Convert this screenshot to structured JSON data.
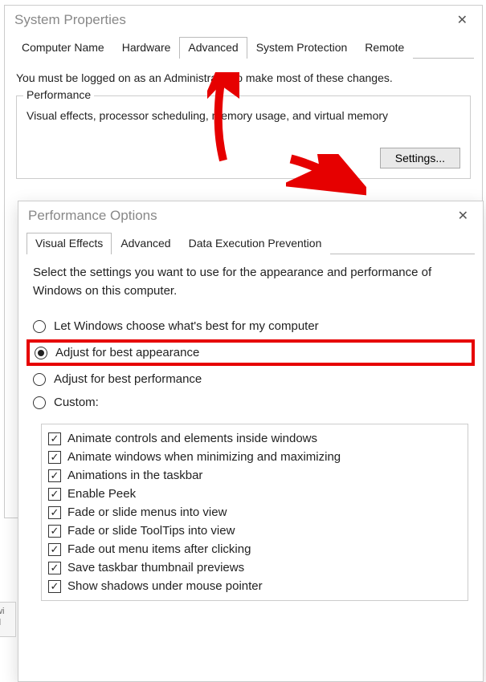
{
  "sysprops": {
    "title": "System Properties",
    "tabs": {
      "computer_name": "Computer Name",
      "hardware": "Hardware",
      "advanced": "Advanced",
      "system_protection": "System Protection",
      "remote": "Remote"
    },
    "instruction": "You must be logged on as an Administrator to make most of these changes.",
    "performance": {
      "group_label": "Performance",
      "description": "Visual effects, processor scheduling, memory usage, and virtual memory",
      "settings_button": "Settings..."
    }
  },
  "perfopts": {
    "title": "Performance Options",
    "tabs": {
      "visual_effects": "Visual Effects",
      "advanced": "Advanced",
      "dep": "Data Execution Prevention"
    },
    "instruction": "Select the settings you want to use for the appearance and performance of Windows on this computer.",
    "radios": {
      "let_windows": "Let Windows choose what's best for my computer",
      "best_appearance": "Adjust for best appearance",
      "best_performance": "Adjust for best performance",
      "custom": "Custom:"
    },
    "checks": [
      "Animate controls and elements inside windows",
      "Animate windows when minimizing and maximizing",
      "Animations in the taskbar",
      "Enable Peek",
      "Fade or slide menus into view",
      "Fade or slide ToolTips into view",
      "Fade out menu items after clicking",
      "Save taskbar thumbnail previews",
      "Show shadows under mouse pointer"
    ]
  },
  "annotation": {
    "highlight_color": "#e60000"
  }
}
